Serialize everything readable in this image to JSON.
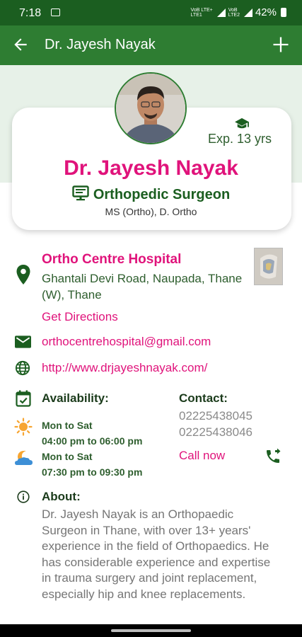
{
  "status_bar": {
    "time": "7:18",
    "net1_top": "VoB LTE+",
    "net1_bottom": "LTE1",
    "net2_top": "VoB",
    "net2_bottom": "LTE2",
    "battery": "42%"
  },
  "app_bar": {
    "title": "Dr. Jayesh Nayak",
    "icons": [
      "back-arrow-icon",
      "add-icon"
    ]
  },
  "profile": {
    "name": "Dr. Jayesh Nayak",
    "experience": "Exp. 13 yrs",
    "specialty": "Orthopedic Surgeon",
    "qualification": "MS (Ortho), D. Ortho"
  },
  "clinic": {
    "name": "Ortho Centre Hospital",
    "address": "Ghantali Devi Road, Naupada, Thane (W), Thane",
    "directions_label": "Get Directions",
    "email": "orthocentrehospital@gmail.com",
    "website": "http://www.drjayeshnayak.com/"
  },
  "availability": {
    "label": "Availability:",
    "slots": [
      {
        "days": "Mon to Sat",
        "time": "04:00 pm to 06:00 pm",
        "icon": "sun-icon"
      },
      {
        "days": "Mon to Sat",
        "time": "07:30 pm to 09:30 pm",
        "icon": "moon-cloud-icon"
      }
    ]
  },
  "contact": {
    "label": "Contact:",
    "phones": [
      "02225438045",
      "02225438046"
    ],
    "call_label": "Call now"
  },
  "about": {
    "label": "About:",
    "text": "Dr. Jayesh Nayak is an Orthopaedic Surgeon in Thane, with over 13+ years' experience in the field of Orthopaedics. He has considerable experience and expertise in trauma surgery and joint replacement, especially hip and knee replacements."
  },
  "colors": {
    "primary": "#2e7d32",
    "dark_primary": "#1b5e20",
    "accent": "#e0137b",
    "band": "#e7f1e8"
  }
}
